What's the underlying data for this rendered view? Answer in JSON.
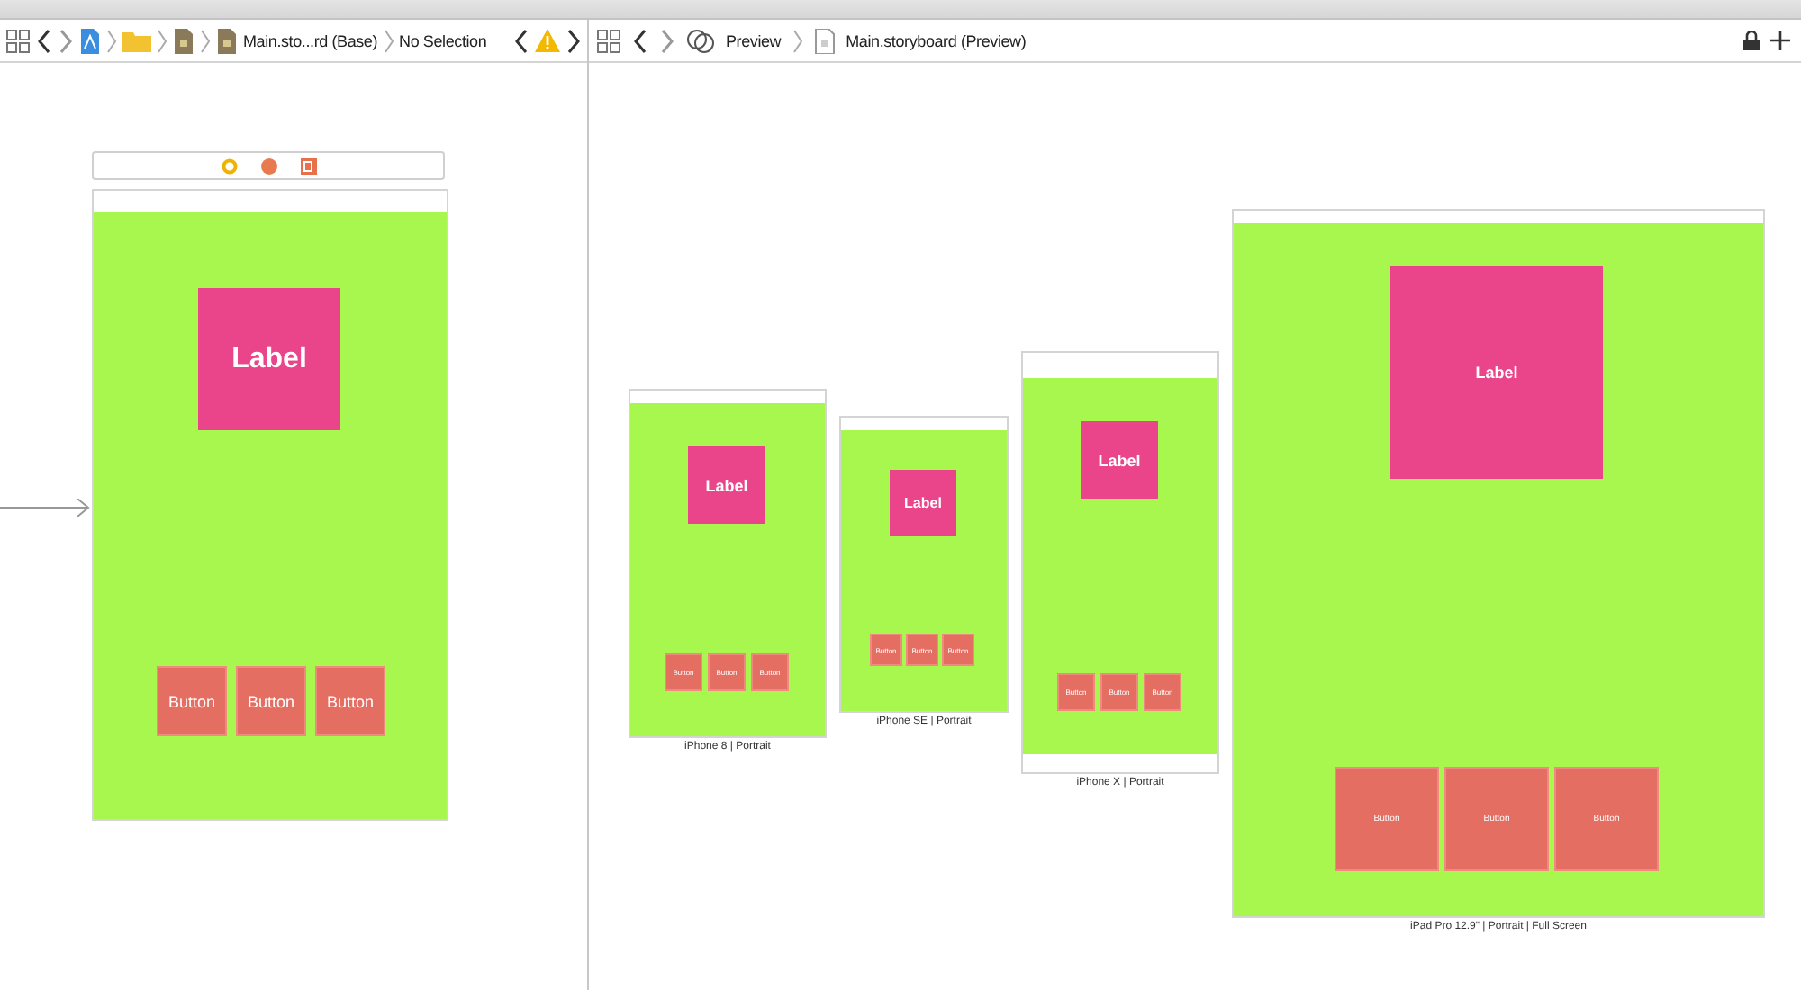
{
  "jump_bar_left": {
    "file": "Main.sto...rd (Base)",
    "selection": "No Selection"
  },
  "jump_bar_right": {
    "editor": "Preview",
    "file": "Main.storyboard (Preview)"
  },
  "scene": {
    "label": "Label",
    "buttons": [
      "Button",
      "Button",
      "Button"
    ]
  },
  "previews": [
    {
      "label": "Label",
      "buttons": [
        "Button",
        "Button",
        "Button"
      ],
      "caption": "iPhone 8 | Portrait"
    },
    {
      "label": "Label",
      "buttons": [
        "Button",
        "Button",
        "Button"
      ],
      "caption": "iPhone SE | Portrait"
    },
    {
      "label": "Label",
      "buttons": [
        "Button",
        "Button",
        "Button"
      ],
      "caption": "iPhone X | Portrait"
    },
    {
      "label": "Label",
      "buttons": [
        "Button",
        "Button",
        "Button"
      ],
      "caption": "iPad Pro 12.9\" | Portrait | Full Screen"
    }
  ]
}
